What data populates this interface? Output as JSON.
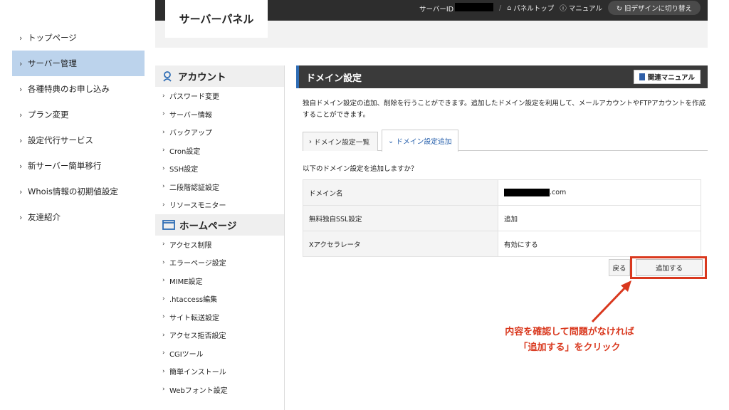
{
  "left_nav": {
    "items": [
      {
        "label": "トップページ",
        "active": false
      },
      {
        "label": "サーバー管理",
        "active": true
      },
      {
        "label": "各種特典のお申し込み",
        "active": false
      },
      {
        "label": "プラン変更",
        "active": false
      },
      {
        "label": "設定代行サービス",
        "active": false
      },
      {
        "label": "新サーバー簡単移行",
        "active": false
      },
      {
        "label": "Whois情報の初期値設定",
        "active": false
      },
      {
        "label": "友達紹介",
        "active": false
      }
    ]
  },
  "header": {
    "title": "サーバーパネル",
    "server_id_label": "サーバーID",
    "separator": "/",
    "panel_top": "パネルトップ",
    "manual": "マニュアル",
    "old_design": "旧デザインに切り替え"
  },
  "mid_menu": {
    "account_title": "アカウント",
    "account_items": [
      "パスワード変更",
      "サーバー情報",
      "バックアップ",
      "Cron設定",
      "SSH設定",
      "二段階認証設定",
      "リソースモニター"
    ],
    "homepage_title": "ホームページ",
    "homepage_items": [
      "アクセス制限",
      "エラーページ設定",
      "MIME設定",
      ".htaccess編集",
      "サイト転送設定",
      "アクセス拒否設定",
      "CGIツール",
      "簡単インストール",
      "Webフォント設定"
    ]
  },
  "main": {
    "title": "ドメイン設定",
    "manual_button": "関連マニュアル",
    "description": "独自ドメイン設定の追加、削除を行うことができます。追加したドメイン設定を利用して、メールアカウントやFTPアカウントを作成することができます。",
    "tabs": [
      "ドメイン設定一覧",
      "ドメイン設定追加"
    ],
    "confirm_text": "以下のドメイン設定を追加しますか？",
    "rows": [
      {
        "key": "ドメイン名",
        "value": ".com"
      },
      {
        "key": "無料独自SSL設定",
        "value": "追加"
      },
      {
        "key": "Xアクセラレータ",
        "value": "有効にする"
      }
    ],
    "back_button": "戻る",
    "add_button": "追加する"
  },
  "annotation": {
    "line1": "内容を確認して問題がなければ",
    "line2": "「追加する」をクリック",
    "color": "#d9381e"
  }
}
